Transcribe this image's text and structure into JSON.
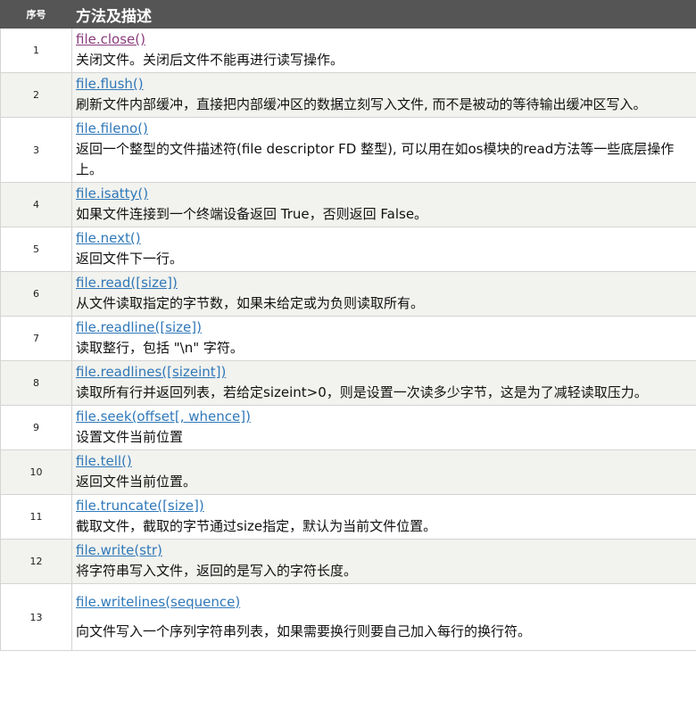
{
  "header": {
    "num": "序号",
    "desc": "方法及描述"
  },
  "rows": [
    {
      "num": "1",
      "method": "file.close()",
      "desc": "关闭文件。关闭后文件不能再进行读写操作。"
    },
    {
      "num": "2",
      "method": "file.flush()",
      "desc": "刷新文件内部缓冲，直接把内部缓冲区的数据立刻写入文件, 而不是被动的等待输出缓冲区写入。"
    },
    {
      "num": "3",
      "method": "file.fileno()",
      "desc": "返回一个整型的文件描述符(file descriptor FD 整型), 可以用在如os模块的read方法等一些底层操作上。"
    },
    {
      "num": "4",
      "method": "file.isatty()",
      "desc": "如果文件连接到一个终端设备返回 True，否则返回 False。"
    },
    {
      "num": "5",
      "method": "file.next()",
      "desc": "返回文件下一行。"
    },
    {
      "num": "6",
      "method": "file.read([size])",
      "desc": "从文件读取指定的字节数，如果未给定或为负则读取所有。"
    },
    {
      "num": "7",
      "method": "file.readline([size])",
      "desc": "读取整行，包括 \"\\n\" 字符。"
    },
    {
      "num": "8",
      "method": "file.readlines([sizeint])",
      "desc": "读取所有行并返回列表，若给定sizeint>0，则是设置一次读多少字节，这是为了减轻读取压力。"
    },
    {
      "num": "9",
      "method": "file.seek(offset[, whence])",
      "desc": "设置文件当前位置"
    },
    {
      "num": "10",
      "method": "file.tell()",
      "desc": "返回文件当前位置。"
    },
    {
      "num": "11",
      "method": "file.truncate([size])",
      "desc": "截取文件，截取的字节通过size指定，默认为当前文件位置。"
    },
    {
      "num": "12",
      "method": "file.write(str)",
      "desc": "将字符串写入文件，返回的是写入的字符长度。"
    },
    {
      "num": "13",
      "method": "file.writelines(sequence)",
      "desc": "向文件写入一个序列字符串列表，如果需要换行则要自己加入每行的换行符。"
    }
  ],
  "colors": {
    "header_bg": "#555555",
    "link": "#2f78b9",
    "visited_link": "#8a3c7d",
    "stripe": "#f2f2ee"
  }
}
